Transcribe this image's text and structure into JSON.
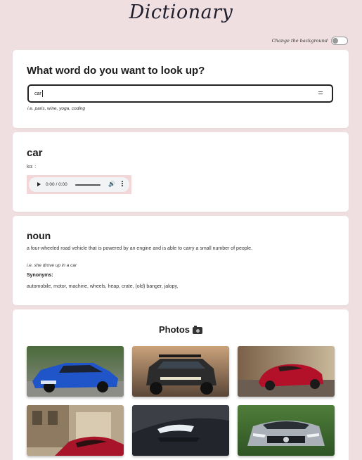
{
  "app": {
    "title": "Dictionary",
    "background_toggle_label": "Change the background"
  },
  "search": {
    "heading": "What word do you want to look up?",
    "value": "car",
    "hint": "i.e. paris, wine, yoga, coding"
  },
  "word": {
    "title": "car",
    "phonetic": "kɑː",
    "audio": {
      "time": "0:00 / 0:00"
    }
  },
  "meaning": {
    "part_of_speech": "noun",
    "definition": "a four-wheeled road vehicle that is powered by an engine and is able to carry a small number of people.",
    "example": "i.e. she drove up in a car",
    "synonyms_label": "Synonyms:",
    "synonyms": "automobile, motor, machine, wheels, heap, crate, (old) banger, jalopy,"
  },
  "photos": {
    "heading": "Photos",
    "items": [
      {
        "subject": "blue-sports-sedan"
      },
      {
        "subject": "black-offroad-pickup"
      },
      {
        "subject": "red-convertible"
      },
      {
        "subject": "red-car-street"
      },
      {
        "subject": "dark-car-headlight"
      },
      {
        "subject": "silver-amg-coupe"
      }
    ]
  },
  "colors": {
    "background": "#efdfe1",
    "card": "#ffffff",
    "audio_frame": "#f3d6d8"
  }
}
